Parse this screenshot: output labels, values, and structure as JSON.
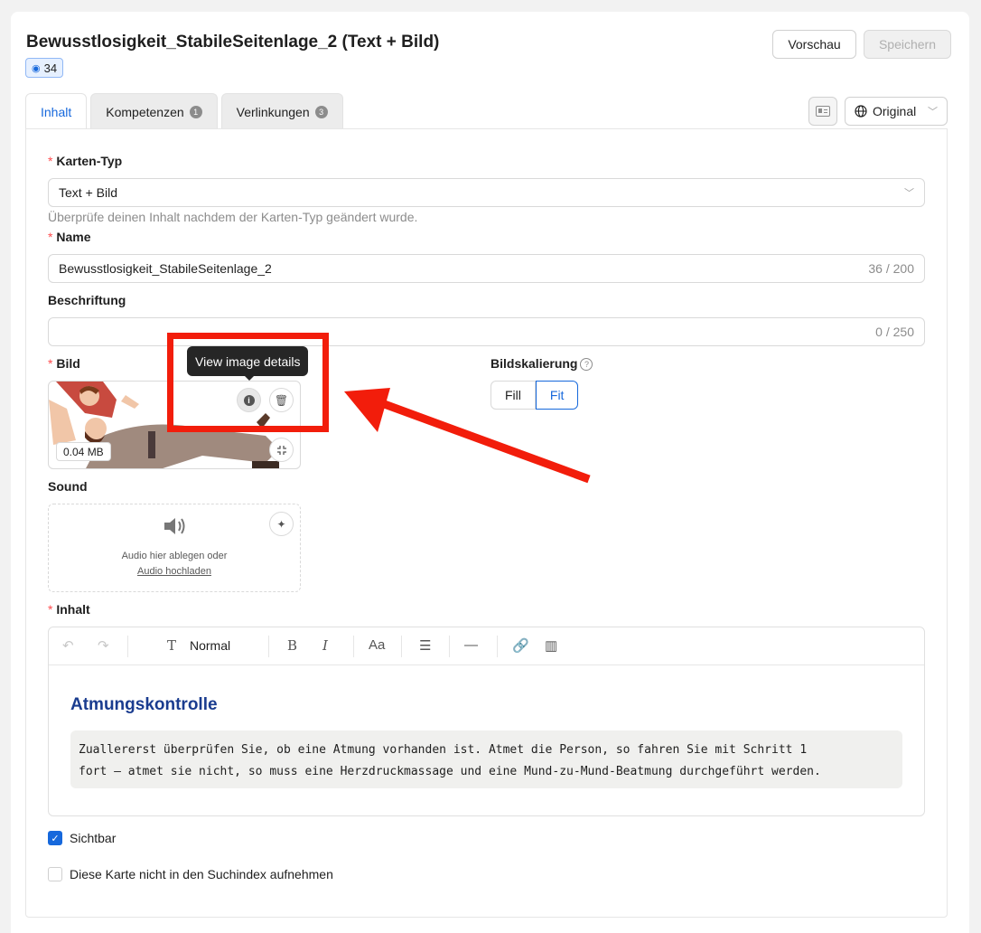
{
  "header": {
    "title": "Bewusstlosigkeit_StabileSeitenlage_2 (Text + Bild)",
    "badge_count": "34",
    "preview_label": "Vorschau",
    "save_label": "Speichern"
  },
  "tabs": [
    {
      "label": "Inhalt",
      "count": ""
    },
    {
      "label": "Kompetenzen",
      "count": "1"
    },
    {
      "label": "Verlinkungen",
      "count": "3"
    }
  ],
  "language": {
    "selected": "Original"
  },
  "form": {
    "card_type": {
      "label": "Karten-Typ",
      "value": "Text + Bild",
      "hint": "Überprüfe deinen Inhalt nachdem der Karten-Typ geändert wurde."
    },
    "name": {
      "label": "Name",
      "value": "Bewusstlosigkeit_StabileSeitenlage_2",
      "count": "36 / 200"
    },
    "caption": {
      "label": "Beschriftung",
      "value": "",
      "count": "0 / 250"
    },
    "image": {
      "label": "Bild",
      "size": "0.04 MB",
      "tooltip": "View image details"
    },
    "scaling": {
      "label": "Bildskalierung",
      "options": [
        "Fill",
        "Fit"
      ],
      "selected": "Fit"
    },
    "sound": {
      "label": "Sound",
      "drop_text": "Audio hier ablegen oder",
      "upload_link": "Audio hochladen"
    },
    "content": {
      "label": "Inhalt",
      "format": "Normal",
      "heading": "Atmungskontrolle",
      "code_line1": "Zuallererst überprüfen Sie, ob eine Atmung vorhanden ist. Atmet die Person, so fahren Sie mit Schritt 1",
      "code_line2": "fort – atmet sie nicht, so muss eine Herzdruckmassage und eine Mund-zu-Mund-Beatmung durchgeführt werden."
    },
    "visible": {
      "label": "Sichtbar",
      "checked": true
    },
    "no_index": {
      "label": "Diese Karte nicht in den Suchindex aufnehmen",
      "checked": false
    }
  },
  "colors": {
    "accent": "#1668dc",
    "annotation": "#f21d0b",
    "heading": "#1a3c8f",
    "required": "#ff4d4f"
  }
}
